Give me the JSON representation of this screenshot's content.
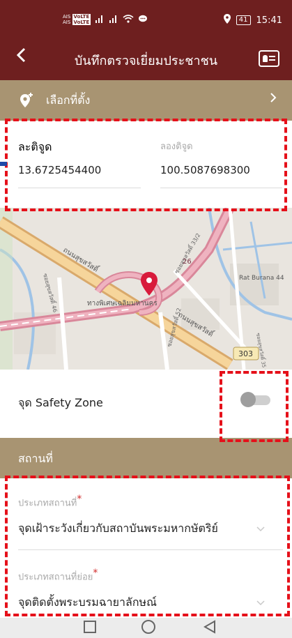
{
  "status_bar": {
    "carrier_1": "AIS",
    "carrier_2": "AIS",
    "volte_1": "VoLTE",
    "volte_2": "VoLTE",
    "battery": "41",
    "time": "15:41"
  },
  "app_bar": {
    "title": "บันทึกตรวจเยี่ยมประชาชน",
    "back_icon": "chevron-left-icon",
    "action_icon": "id-card-icon"
  },
  "location_selector": {
    "label": "เลือกที่ตั้ง"
  },
  "coordinates": {
    "latitude_label": "ละติจูด",
    "latitude_value": "13.6725454400",
    "longitude_label": "ลองติจูด",
    "longitude_value": "100.5087698300"
  },
  "map": {
    "labels": [
      "ถนนสุขสวัสดิ์",
      "ทางพิเศษเฉลิมมหานคร",
      "ซอยสุขสวัสดิ์ 46",
      "ซอยสุขสวัสดิ์ 52",
      "ถนนสุขสวัสดิ์",
      "ซอยสุขสวัสดิ์ 33/2",
      "Rat Burana 44",
      "ซอยสุขสวัสดิ์ 35 แยก 1",
      "26",
      "303"
    ]
  },
  "safety_zone": {
    "label": "จุด Safety Zone",
    "enabled": false
  },
  "place_section": {
    "header": "สถานที่",
    "place_type_label": "ประเภทสถานที่",
    "place_type_value": "จุดเฝ้าระวังเกี่ยวกับสถาบันพระมหากษัตริย์",
    "sub_type_label": "ประเภทสถานที่ย่อย",
    "sub_type_value": "จุดติดตั้งพระบรมฉายาลักษณ์",
    "required_mark": "*"
  },
  "colors": {
    "primary": "#6e1f1f",
    "section": "#a89472",
    "highlight": "#e5101a",
    "pin": "#d81b3b"
  }
}
